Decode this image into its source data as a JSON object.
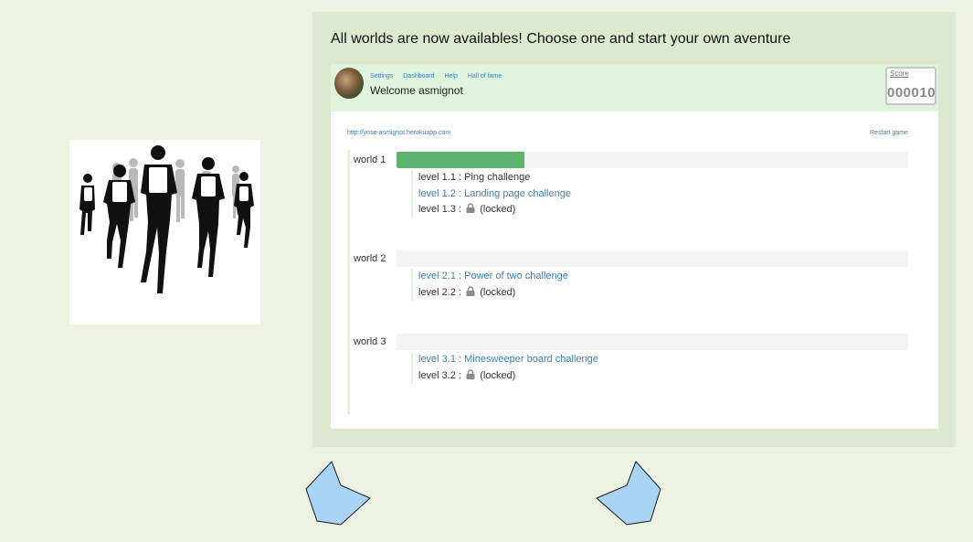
{
  "headline": "All worlds are now availables! Choose one and start your own aventure",
  "header": {
    "nav": [
      "Settings",
      "Dashboard",
      "Help",
      "Hall of fame"
    ],
    "welcome": "Welcome asmignot",
    "score_label": "Score",
    "score_value": "000010"
  },
  "content": {
    "url": "http://yose-asmignot.herokuapp.com",
    "restart_label": "Restart game",
    "locked_suffix": "(locked)",
    "worlds": [
      {
        "label": "world 1",
        "progress": 0.25,
        "levels": [
          {
            "label": "level 1.1 : Ping challenge",
            "state": "done"
          },
          {
            "label": "level 1.2 : Landing page challenge",
            "state": "open"
          },
          {
            "label": "level 1.3 :",
            "state": "locked"
          }
        ]
      },
      {
        "label": "world 2",
        "progress": 0,
        "levels": [
          {
            "label": "level 2.1 : Power of two challenge",
            "state": "open"
          },
          {
            "label": "level 2.2 :",
            "state": "locked"
          }
        ]
      },
      {
        "label": "world 3",
        "progress": 0,
        "levels": [
          {
            "label": "level 3.1 : Minesweeper board challenge",
            "state": "open"
          },
          {
            "label": "level 3.2 :",
            "state": "locked"
          }
        ]
      }
    ]
  },
  "colors": {
    "background": "#edf2e3",
    "panel": "#dde8cf",
    "header_bar": "#e0f3dc",
    "link": "#3d7fb6",
    "progress_fill": "#5cb46e",
    "arrow_fill": "#a8d4f5"
  },
  "icons": {
    "lock": "lock-icon",
    "prev": "prev-arrow-icon",
    "next": "next-arrow-icon"
  }
}
